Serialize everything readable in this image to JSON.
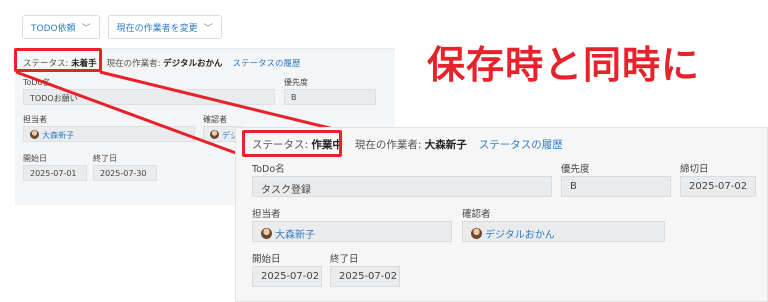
{
  "back": {
    "toolbar": {
      "todo_request_label": "TODO依頼",
      "change_worker_label": "現在の作業者を変更"
    },
    "status_label": "ステータス:",
    "status_value": "未着手",
    "worker_label": "現在の作業者:",
    "worker_value": "デジタルおかん",
    "status_history_link": "ステータスの履歴",
    "todo_name_label": "ToDo名",
    "todo_name_value": "TODOお願い",
    "priority_label": "優先度",
    "priority_value": "B",
    "assignee_label": "担当者",
    "assignee_value": "大森新子",
    "reviewer_label": "確認者",
    "reviewer_value": "デジタ",
    "start_label": "開始日",
    "start_value": "2025-07-01",
    "end_label": "終了日",
    "end_value": "2025-07-30"
  },
  "headline": "保存時と同時に",
  "front": {
    "status_label": "ステータス:",
    "status_value": "作業中",
    "worker_label": "現在の作業者:",
    "worker_value": "大森新子",
    "status_history_link": "ステータスの履歴",
    "todo_name_label": "ToDo名",
    "todo_name_value": "タスク登録",
    "priority_label": "優先度",
    "priority_value": "B",
    "deadline_label": "締切日",
    "deadline_value": "2025-07-02",
    "assignee_label": "担当者",
    "assignee_value": "大森新子",
    "reviewer_label": "確認者",
    "reviewer_value": "デジタルおかん",
    "start_label": "開始日",
    "start_value": "2025-07-02",
    "end_label": "終了日",
    "end_value": "2025-07-02"
  },
  "colors": {
    "highlight_red": "#e8222b",
    "link_blue": "#2f7cc4",
    "field_bg": "#e9ebed"
  },
  "icons": [
    "chevron-down-icon",
    "avatar-icon"
  ]
}
